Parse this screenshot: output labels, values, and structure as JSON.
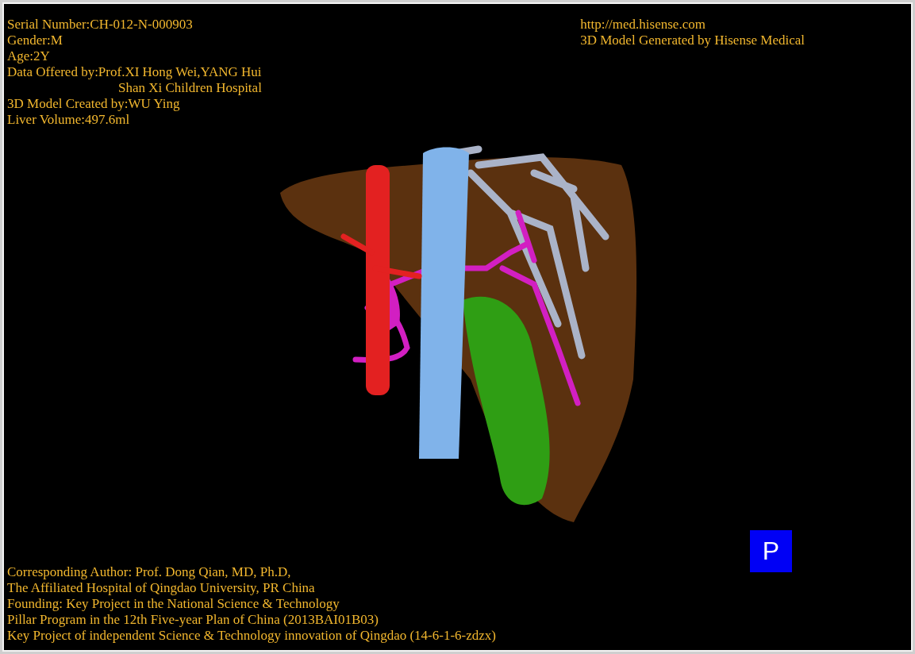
{
  "patient_info": [
    {
      "text": "Serial Number:CH-012-N-000903",
      "kind": "line"
    },
    {
      "text": "Gender:M",
      "kind": "line"
    },
    {
      "text": "Age:2Y",
      "kind": "line"
    },
    {
      "text": "Data Offered by:Prof.XI Hong Wei,YANG Hui",
      "kind": "line"
    },
    {
      "text": "Shan Xi Children Hospital",
      "kind": "indent"
    },
    {
      "text": "3D Model Created by:WU Ying",
      "kind": "line"
    },
    {
      "text": "Liver Volume:497.6ml",
      "kind": "line"
    }
  ],
  "generator_info": [
    "http://med.hisense.com",
    "3D Model Generated by Hisense Medical"
  ],
  "credits": [
    "Corresponding Author: Prof. Dong Qian, MD, Ph.D,",
    "The Affiliated Hospital of Qingdao University, PR China",
    "Founding: Key Project in the National Science & Technology",
    "Pillar Program in the 12th Five-year Plan of China (2013BAI01B03)",
    "Key Project of independent Science & Technology innovation of Qingdao (14-6-1-6-zdzx)"
  ],
  "orientation_cube": {
    "label": "P"
  }
}
